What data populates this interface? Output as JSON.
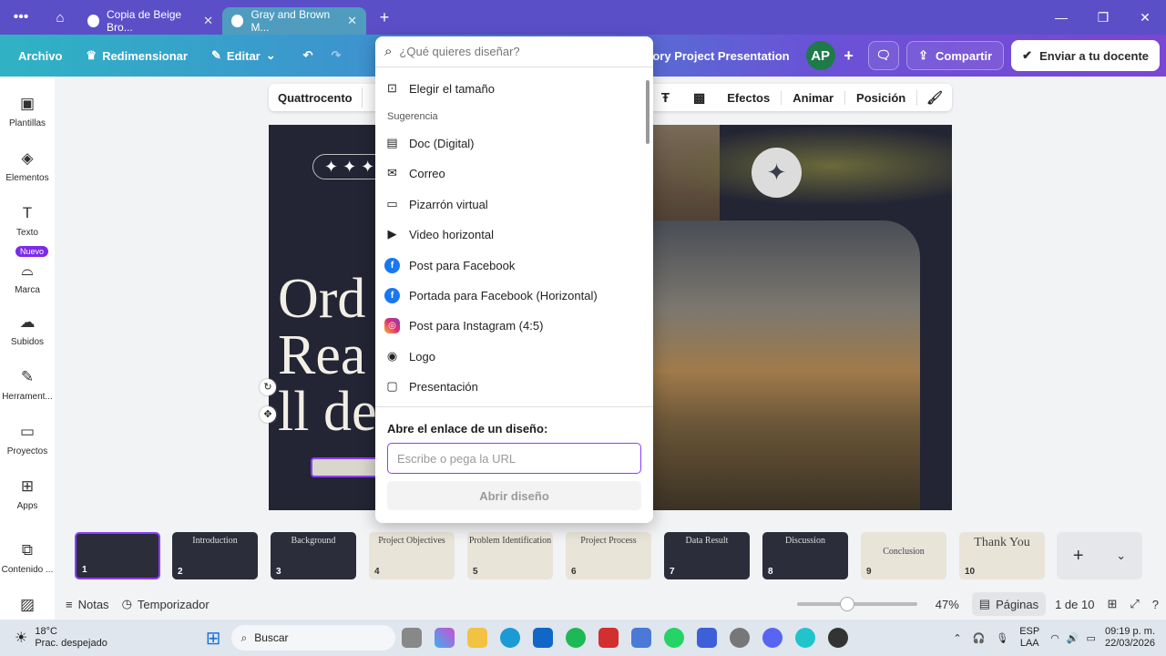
{
  "browser": {
    "tabs": [
      {
        "label": "Copia de Beige Bro..."
      },
      {
        "label": "Gray and Brown M..."
      }
    ]
  },
  "toolbar": {
    "archivo": "Archivo",
    "redimensionar": "Redimensionar",
    "editar": "Editar",
    "project_title": "History Project Presentation",
    "avatar": "AP",
    "compartir": "Compartir",
    "enviar": "Enviar a tu docente"
  },
  "rail": [
    {
      "label": "Plantillas",
      "icon": "templates-icon"
    },
    {
      "label": "Elementos",
      "icon": "elements-icon"
    },
    {
      "label": "Texto",
      "icon": "text-icon"
    },
    {
      "label": "Marca",
      "icon": "brand-icon"
    },
    {
      "label": "Subidos",
      "icon": "uploads-icon"
    },
    {
      "label": "Herrament...",
      "icon": "tools-icon"
    },
    {
      "label": "Proyectos",
      "icon": "folder-icon"
    },
    {
      "label": "Apps",
      "icon": "apps-icon"
    },
    {
      "label": "Contenido ...",
      "icon": "content-icon"
    }
  ],
  "rail_badge": "Nuevo",
  "context": {
    "font": "Quattrocento",
    "efectos": "Efectos",
    "animar": "Animar",
    "posicion": "Posición"
  },
  "slide": {
    "title_fragment_1": "Ord",
    "title_fragment_2": "Rea",
    "title_fragment_3": "ll de"
  },
  "dropdown": {
    "search_placeholder": "¿Qué quieres diseñar?",
    "choose_size": "Elegir el tamaño",
    "section": "Sugerencia",
    "items": [
      "Doc (Digital)",
      "Correo",
      "Pizarrón virtual",
      "Video horizontal",
      "Post para Facebook",
      "Portada para Facebook (Horizontal)",
      "Post para Instagram (4:5)",
      "Logo",
      "Presentación"
    ],
    "link_heading": "Abre el enlace de un diseño:",
    "url_placeholder": "Escribe o pega la URL",
    "open_button": "Abrir diseño"
  },
  "pages": [
    {
      "n": "1",
      "title": ""
    },
    {
      "n": "2",
      "title": "Introduction"
    },
    {
      "n": "3",
      "title": "Background"
    },
    {
      "n": "4",
      "title": "Project Objectives"
    },
    {
      "n": "5",
      "title": "Problem Identification"
    },
    {
      "n": "6",
      "title": "Project Process"
    },
    {
      "n": "7",
      "title": "Data Result"
    },
    {
      "n": "8",
      "title": "Discussion"
    },
    {
      "n": "9",
      "title": "Conclusion"
    },
    {
      "n": "10",
      "title": "Thank You"
    }
  ],
  "footer": {
    "notas": "Notas",
    "temporizador": "Temporizador",
    "zoom": "47%",
    "paginas": "Páginas",
    "page_count": "1 de 10"
  },
  "taskbar": {
    "temp": "18°C",
    "weather": "Prac. despejado",
    "search": "Buscar",
    "lang1": "ESP",
    "lang2": "LAA",
    "time": "09:19 p. m.",
    "date": "22/03/2026"
  }
}
